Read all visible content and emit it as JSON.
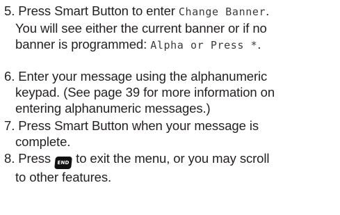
{
  "steps": [
    {
      "number": "5.",
      "line1_pre": "Press Smart Button to enter ",
      "line1_lcd": "Change Banner",
      "line1_post": ".",
      "line2": "You will see either the current banner or if no",
      "line3_pre": "banner is programmed: ",
      "line3_lcd": "Alpha or Press *",
      "line3_post": "."
    },
    {
      "number": "6.",
      "line1": "Enter your message using the alphanumeric",
      "line2": "keypad. (See page 39 for more information on",
      "line3": "entering alphanumeric messages.)"
    },
    {
      "number": "7.",
      "line1": "Press Smart Button when your message is",
      "line2": "complete."
    },
    {
      "number": "8.",
      "line1_pre": "Press ",
      "key_label": "END",
      "key_icon": "end-key-icon",
      "line1_post": " to exit the menu, or you may scroll",
      "line2": "to other features."
    }
  ]
}
